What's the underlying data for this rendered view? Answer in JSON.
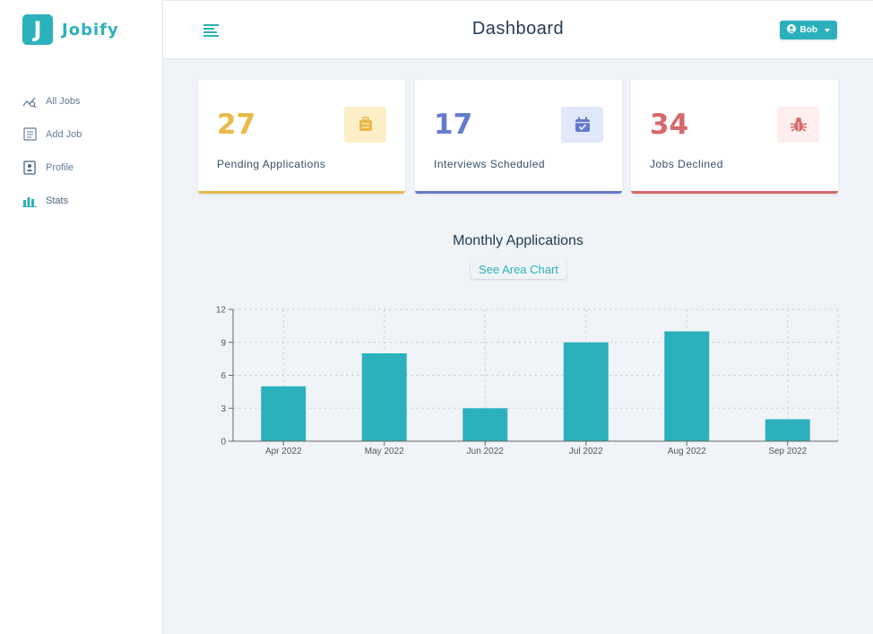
{
  "app": {
    "logo_letter": "J",
    "logo_text": "Jobify"
  },
  "sidebar": {
    "items": [
      {
        "label": "All Jobs",
        "icon": "chart-line-icon"
      },
      {
        "label": "Add Job",
        "icon": "form-icon"
      },
      {
        "label": "Profile",
        "icon": "id-card-icon"
      },
      {
        "label": "Stats",
        "icon": "stats-icon"
      }
    ]
  },
  "header": {
    "title": "Dashboard",
    "user": "Bob"
  },
  "stats": [
    {
      "count": "27",
      "label": "Pending Applications",
      "color": "#e9b949",
      "bg": "#fcefc7",
      "icon": "suitcase-icon"
    },
    {
      "count": "17",
      "label": "Interviews Scheduled",
      "color": "#647acb",
      "bg": "#e0e8f9",
      "icon": "calendar-check-icon"
    },
    {
      "count": "34",
      "label": "Jobs Declined",
      "color": "#d66a6a",
      "bg": "#ffeeee",
      "icon": "bug-icon"
    }
  ],
  "chart_section": {
    "title": "Monthly Applications",
    "toggle_label": "See Area Chart"
  },
  "colors": {
    "primary": "#2cb1bc",
    "bar": "#2cb1bc"
  },
  "chart_data": {
    "type": "bar",
    "categories": [
      "Apr 2022",
      "May 2022",
      "Jun 2022",
      "Jul 2022",
      "Aug 2022",
      "Sep 2022"
    ],
    "values": [
      5,
      8,
      3,
      9,
      10,
      2
    ],
    "yticks": [
      0,
      3,
      6,
      9,
      12
    ],
    "ylim": [
      0,
      12
    ],
    "grid": true
  }
}
